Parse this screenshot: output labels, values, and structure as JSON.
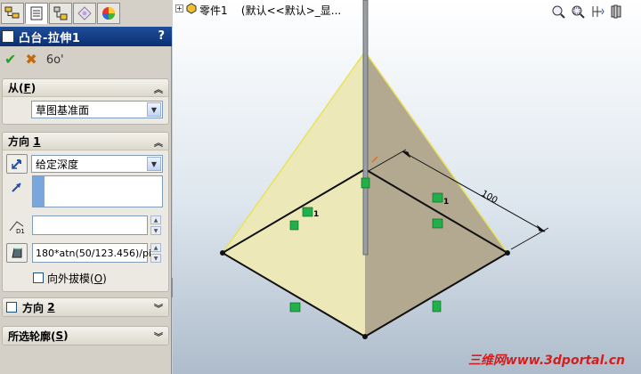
{
  "tree": {
    "part_label": "零件1",
    "config_label": "(默认<<默认>_显..."
  },
  "feature": {
    "title": "凸台-拉伸1",
    "help": "?"
  },
  "confirm": {
    "ok": "✔",
    "cancel": "✖",
    "preview": "6o'"
  },
  "from_group": {
    "title": "从",
    "key": "F",
    "value": "草图基准面"
  },
  "direction1": {
    "title": "方向",
    "index": "1",
    "end_condition": "给定深度",
    "depth_value": "",
    "draft_angle": "180*atn(50/123.456)/pi",
    "draft_outward_label": "向外拔模(",
    "draft_outward_key": "O",
    "draft_outward_close": ")"
  },
  "direction2": {
    "title": "方向",
    "index": "2"
  },
  "selected_contours": {
    "title": "所选轮廓(",
    "key": "S",
    "close": ")"
  },
  "dimension": {
    "value": "100"
  },
  "relation_markers": {
    "count1": "1",
    "count2": "1"
  },
  "watermark": {
    "text": "三维网www.3dportal.cn"
  },
  "colors": {
    "header": "#0a2f72",
    "face_light": "#ece8b8",
    "face_dark": "#b3a990",
    "edge": "#e8e35a"
  }
}
